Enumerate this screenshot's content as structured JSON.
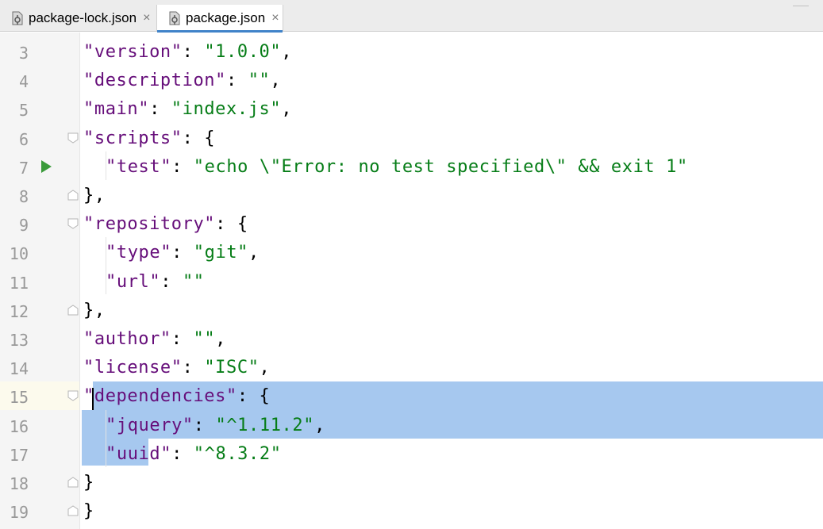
{
  "tabs": [
    {
      "label": "package-lock.json",
      "close": "×",
      "icon": "json-file-icon"
    },
    {
      "label": "package.json",
      "close": "×",
      "icon": "json-file-icon",
      "active": true
    }
  ],
  "editor": {
    "current_line": 15,
    "selection": "lines 15-17",
    "lines": [
      {
        "n": "3",
        "tokens": [
          [
            "k",
            "\"version\""
          ],
          [
            "p",
            ": "
          ],
          [
            "s",
            "\"1.0.0\""
          ],
          [
            "p",
            ","
          ]
        ],
        "indent": 1
      },
      {
        "n": "4",
        "tokens": [
          [
            "k",
            "\"description\""
          ],
          [
            "p",
            ": "
          ],
          [
            "s",
            "\"\""
          ],
          [
            "p",
            ","
          ]
        ],
        "indent": 1
      },
      {
        "n": "5",
        "tokens": [
          [
            "k",
            "\"main\""
          ],
          [
            "p",
            ": "
          ],
          [
            "s",
            "\"index.js\""
          ],
          [
            "p",
            ","
          ]
        ],
        "indent": 1
      },
      {
        "n": "6",
        "tokens": [
          [
            "k",
            "\"scripts\""
          ],
          [
            "p",
            ": {"
          ]
        ],
        "indent": 1
      },
      {
        "n": "7",
        "tokens": [
          [
            "k",
            "\"test\""
          ],
          [
            "p",
            ": "
          ],
          [
            "s",
            "\"echo \\\"Error: no test specified\\\" && exit 1\""
          ]
        ],
        "indent": 2
      },
      {
        "n": "8",
        "tokens": [
          [
            "p",
            "},"
          ]
        ],
        "indent": 1
      },
      {
        "n": "9",
        "tokens": [
          [
            "k",
            "\"repository\""
          ],
          [
            "p",
            ": {"
          ]
        ],
        "indent": 1
      },
      {
        "n": "10",
        "tokens": [
          [
            "k",
            "\"type\""
          ],
          [
            "p",
            ": "
          ],
          [
            "s",
            "\"git\""
          ],
          [
            "p",
            ","
          ]
        ],
        "indent": 2
      },
      {
        "n": "11",
        "tokens": [
          [
            "k",
            "\"url\""
          ],
          [
            "p",
            ": "
          ],
          [
            "s",
            "\"\""
          ]
        ],
        "indent": 2
      },
      {
        "n": "12",
        "tokens": [
          [
            "p",
            "},"
          ]
        ],
        "indent": 1
      },
      {
        "n": "13",
        "tokens": [
          [
            "k",
            "\"author\""
          ],
          [
            "p",
            ": "
          ],
          [
            "s",
            "\"\""
          ],
          [
            "p",
            ","
          ]
        ],
        "indent": 1
      },
      {
        "n": "14",
        "tokens": [
          [
            "k",
            "\"license\""
          ],
          [
            "p",
            ": "
          ],
          [
            "s",
            "\"ISC\""
          ],
          [
            "p",
            ","
          ]
        ],
        "indent": 1
      },
      {
        "n": "15",
        "tokens": [
          [
            "k",
            "\"dependencies\""
          ],
          [
            "p",
            ": {"
          ]
        ],
        "indent": 1
      },
      {
        "n": "16",
        "tokens": [
          [
            "k",
            "\"jquery\""
          ],
          [
            "p",
            ": "
          ],
          [
            "s",
            "\"^1.11.2\""
          ],
          [
            "p",
            ","
          ]
        ],
        "indent": 2
      },
      {
        "n": "17",
        "tokens": [
          [
            "k",
            "\"uuid\""
          ],
          [
            "p",
            ": "
          ],
          [
            "s",
            "\"^8.3.2\""
          ]
        ],
        "indent": 2
      },
      {
        "n": "18",
        "tokens": [
          [
            "p",
            "}"
          ]
        ],
        "indent": 1
      },
      {
        "n": "19",
        "tokens": [
          [
            "p",
            "}"
          ]
        ],
        "indent": 0
      }
    ]
  },
  "colors": {
    "key": "#660e7a",
    "string": "#067d17",
    "selection": "#a6c8ef",
    "gutter": "#f5f5f5",
    "run_icon": "#3a9a3a"
  }
}
